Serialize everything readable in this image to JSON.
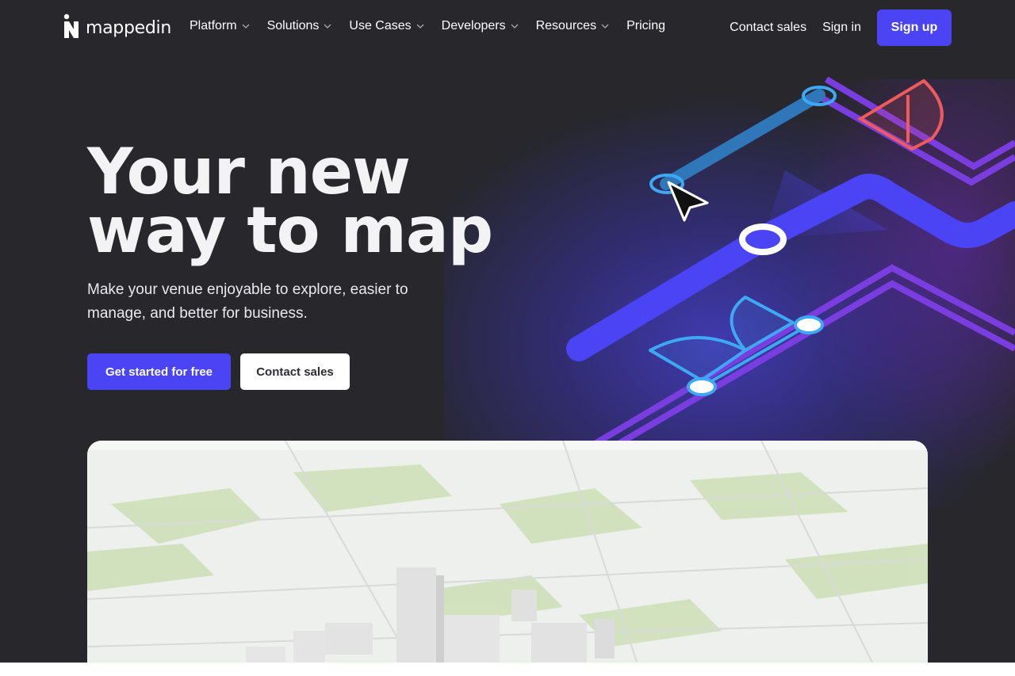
{
  "brand": {
    "name": "mappedin",
    "accent": "#4a44f5"
  },
  "nav": {
    "items": [
      {
        "label": "Platform",
        "has_dropdown": true
      },
      {
        "label": "Solutions",
        "has_dropdown": true
      },
      {
        "label": "Use Cases",
        "has_dropdown": true
      },
      {
        "label": "Developers",
        "has_dropdown": true
      },
      {
        "label": "Resources",
        "has_dropdown": true
      },
      {
        "label": "Pricing",
        "has_dropdown": false
      }
    ],
    "contact_sales": "Contact sales",
    "sign_in": "Sign in",
    "sign_up": "Sign up"
  },
  "hero": {
    "title_line1": "Your new",
    "title_line2": "way to map",
    "subtitle_line1": "Make your venue enjoyable to explore, easier to",
    "subtitle_line2": "manage, and better for business.",
    "cta_primary": "Get started for free",
    "cta_secondary": "Contact sales"
  },
  "icons": {
    "logo": "mappedin-logo-icon",
    "chevron": "chevron-down-icon",
    "cursor": "cursor-arrow-icon"
  }
}
